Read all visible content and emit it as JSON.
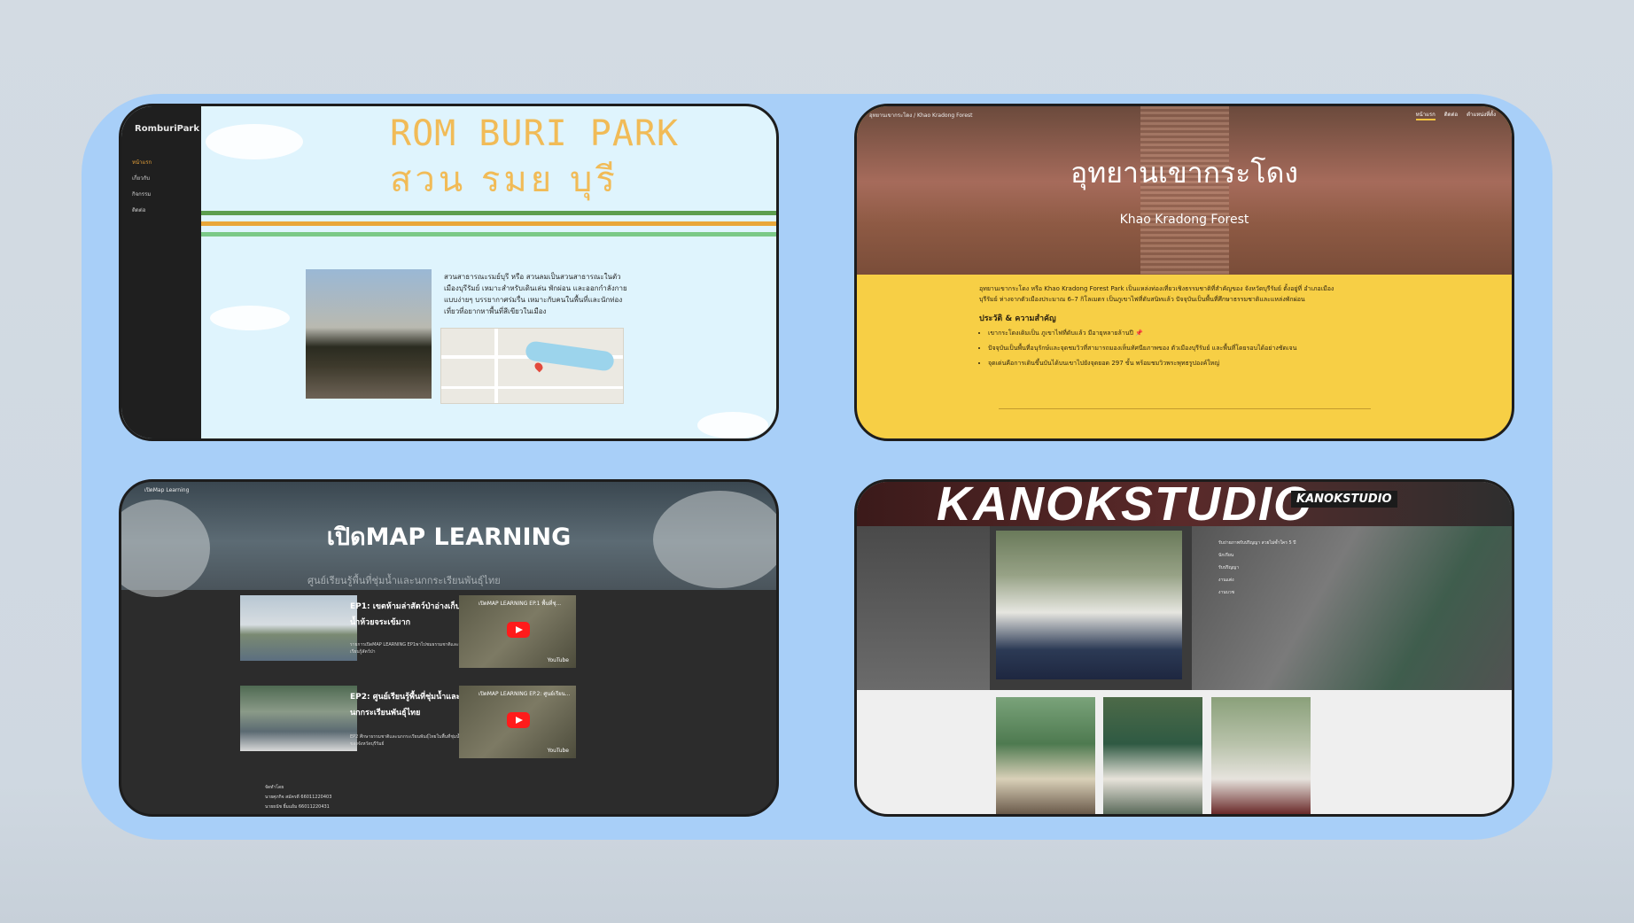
{
  "card1": {
    "brand": "RomburiPark",
    "nav": [
      "หน้าแรก",
      "เกี่ยวกับ",
      "กิจกรรม",
      "ติดต่อ"
    ],
    "title_en": "ROM BURI PARK",
    "title_th": "สวน รมย บุรี",
    "paragraph": "สวนสาธารณะรมย์บุรี หรือ สวนลมเป็นสวนสาธารณะในตัวเมืองบุรีรัมย์ เหมาะสำหรับเดินเล่น พักผ่อน และออกกำลังกายแบบง่ายๆ บรรยากาศร่มรื่น เหมาะกับคนในพื้นที่และนักท่องเที่ยวที่อยากหาพื้นที่สีเขียวในเมือง",
    "stripe_colors": [
      "#5c9e4f",
      "#e9a739",
      "#7bc987"
    ]
  },
  "card2": {
    "breadcrumb": "อุทยานเขากระโดง / Khao Kradong Forest",
    "nav": [
      "หน้าแรก",
      "ติดต่อ",
      "ตำแหน่งที่ตั้ง"
    ],
    "title_th": "อุทยานเขากระโดง",
    "title_en": "Khao Kradong Forest",
    "intro": "อุทยานเขากระโดง หรือ Khao Kradong Forest Park เป็นแหล่งท่องเที่ยวเชิงธรรมชาติที่สำคัญของ จังหวัดบุรีรัมย์ ตั้งอยู่ที่ อำเภอเมืองบุรีรัมย์ ห่างจากตัวเมืองประมาณ 6–7 กิโลเมตร เป็นภูเขาไฟที่ดับสนิทแล้ว ปัจจุบันเป็นพื้นที่ศึกษาธรรมชาติและแหล่งพักผ่อน",
    "section": "ประวัติ & ความสำคัญ",
    "bullets": [
      "เขากระโดงเดิมเป็น ภูเขาไฟที่ดับแล้ว มีอายุหลายล้านปี 📌",
      "ปัจจุบันเป็นพื้นที่อนุรักษ์และจุดชมวิวที่สามารถมองเห็นทัศนียภาพของ ตัวเมืองบุรีรัมย์ และพื้นที่โดยรอบได้อย่างชัดเจน",
      "จุดเด่นคือการเดินขึ้นบันได้บนเขาไปยังจุดยอด 297 ขั้น พร้อมชมวิวพระพุทธรูปองค์ใหญ่"
    ]
  },
  "card3": {
    "breadcrumb": "เปิดMap Learning",
    "title": "เปิดMAP LEARNING",
    "banner": "ศูนย์เรียนรู้พื้นที่ชุ่มน้ำและนกกระเรียนพันธุ์ไทย",
    "episodes": [
      {
        "title": "EP1: เขตห้ามล่าสัตว์ป่าอ่างเก็บน้ำห้วยจระเข้มาก",
        "desc": "รายการเปิดMAP LEARNING EP1พาไปชมธรรมชาติและเรียนรู้สัตว์ป่า",
        "video": "เปิดMAP LEARNING EP.1 พื้นที่ชุ่..."
      },
      {
        "title": "EP2: ศูนย์เรียนรู้พื้นที่ชุ่มน้ำและนกกระเรียนพันธุ์ไทย",
        "desc": "EP2 ศึกษาธรรมชาติและนกกระเรียนพันธุ์ไทยในพื้นที่ชุ่มน้ำของจังหวัดบุรีรัมย์",
        "video": "เปิดMAP LEARNING EP.2: ศูนย์เรียน..."
      }
    ],
    "youtube_label": "YouTube",
    "credits": [
      "จัดทำโดย",
      "นายศุภกิจ สมัครดี 66011220403",
      "นายธนัช ยิ้มแย้ม 66011220431"
    ]
  },
  "card4": {
    "banner": "KANOKSTUDIO",
    "logo": "KANOKSTUDIO",
    "heading": "รับถ่ายภาพรับปริญญา สวยไม่ซ้ำใคร 5 ปี",
    "menu": [
      "นักเรียน",
      "รับปริญญา",
      "งานแต่ง",
      "งานบวช"
    ]
  }
}
